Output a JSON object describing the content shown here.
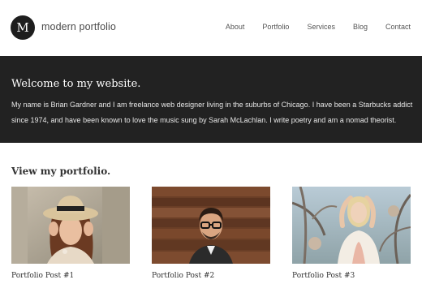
{
  "site": {
    "logo_letter": "M",
    "title": "modern portfolio"
  },
  "nav": {
    "items": [
      "About",
      "Portfolio",
      "Services",
      "Blog",
      "Contact"
    ]
  },
  "hero": {
    "heading": "Welcome to my website.",
    "body": "My name is Brian Gardner and I am freelance web designer living in the suburbs of Chicago. I have been a Starbucks addict since 1974, and have been known to love the music sung by Sarah McLachlan. I write poetry and am a nomad theorist."
  },
  "portfolio": {
    "heading": "View my portfolio.",
    "posts": [
      {
        "title": "Portfolio Post #1",
        "image": "woman-in-hat-photo"
      },
      {
        "title": "Portfolio Post #2",
        "image": "man-with-glasses-photo"
      },
      {
        "title": "Portfolio Post #3",
        "image": "blonde-woman-photo"
      }
    ]
  },
  "colors": {
    "hero_bg": "#222222",
    "logo_bg": "#1e1e1e",
    "text": "#333333"
  }
}
